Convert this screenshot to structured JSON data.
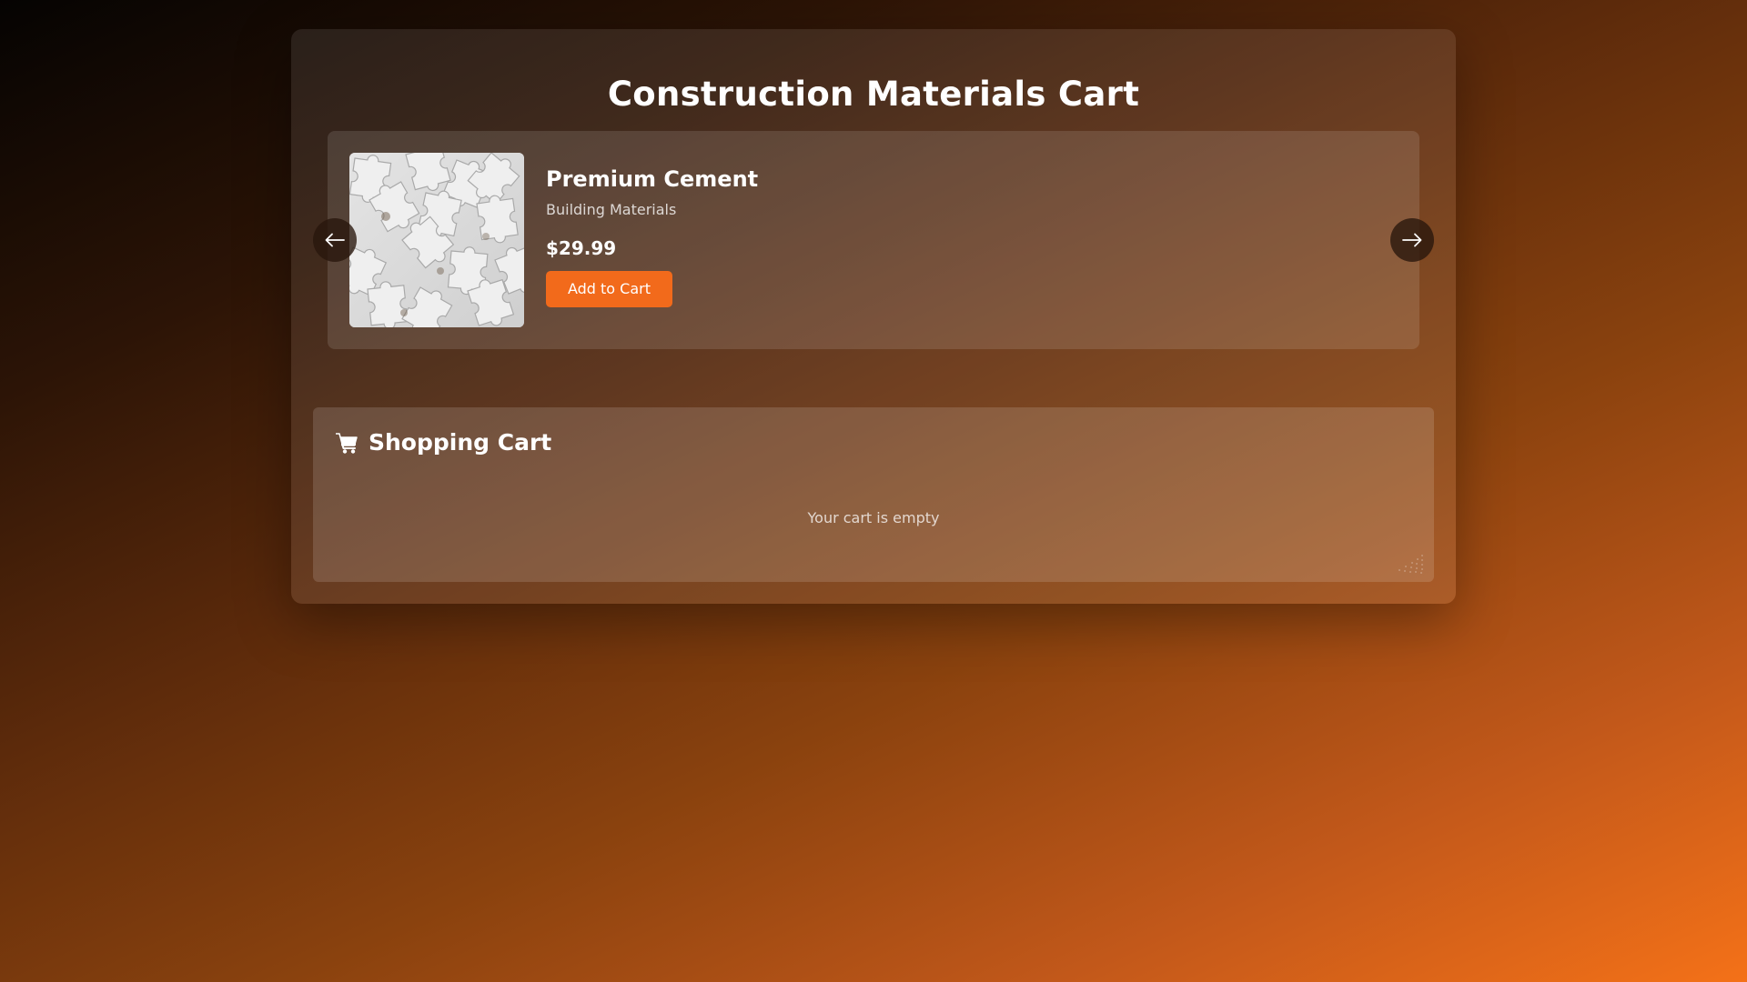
{
  "page": {
    "title": "Construction Materials Cart"
  },
  "carousel": {
    "product": {
      "name": "Premium Cement",
      "category": "Building Materials",
      "price": "$29.99",
      "add_to_cart_label": "Add to Cart",
      "image_icon": "puzzle-pieces-image"
    },
    "prev_icon": "arrow-left-icon",
    "next_icon": "arrow-right-icon"
  },
  "cart": {
    "title": "Shopping Cart",
    "icon": "shopping-cart-icon",
    "empty_message": "Your cart is empty"
  },
  "colors": {
    "accent": "#f26a1b",
    "background_start": "#050302",
    "background_end": "#f47118"
  }
}
